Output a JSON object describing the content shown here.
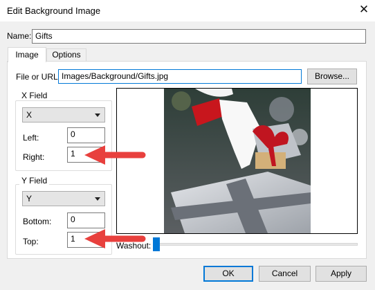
{
  "window": {
    "title": "Edit Background Image",
    "close_glyph": "✕"
  },
  "name": {
    "label": "Name:",
    "value": "Gifts"
  },
  "tabs": [
    {
      "label": "Image",
      "active": true
    },
    {
      "label": "Options",
      "active": false
    }
  ],
  "file": {
    "label": "File or URL:",
    "value": "Images/Background/Gifts.jpg",
    "browse_label": "Browse..."
  },
  "x_field": {
    "group_label": "X Field",
    "selected": "X",
    "left_label": "Left:",
    "left_value": "0",
    "right_label": "Right:",
    "right_value": "1"
  },
  "y_field": {
    "group_label": "Y Field",
    "selected": "Y",
    "bottom_label": "Bottom:",
    "bottom_value": "0",
    "top_label": "Top:",
    "top_value": "1"
  },
  "washout": {
    "label": "Washout:",
    "level": 0
  },
  "buttons": {
    "ok": "OK",
    "cancel": "Cancel",
    "apply": "Apply"
  },
  "colors": {
    "accent": "#0078d7",
    "annotation_arrow": "#e8403d"
  }
}
